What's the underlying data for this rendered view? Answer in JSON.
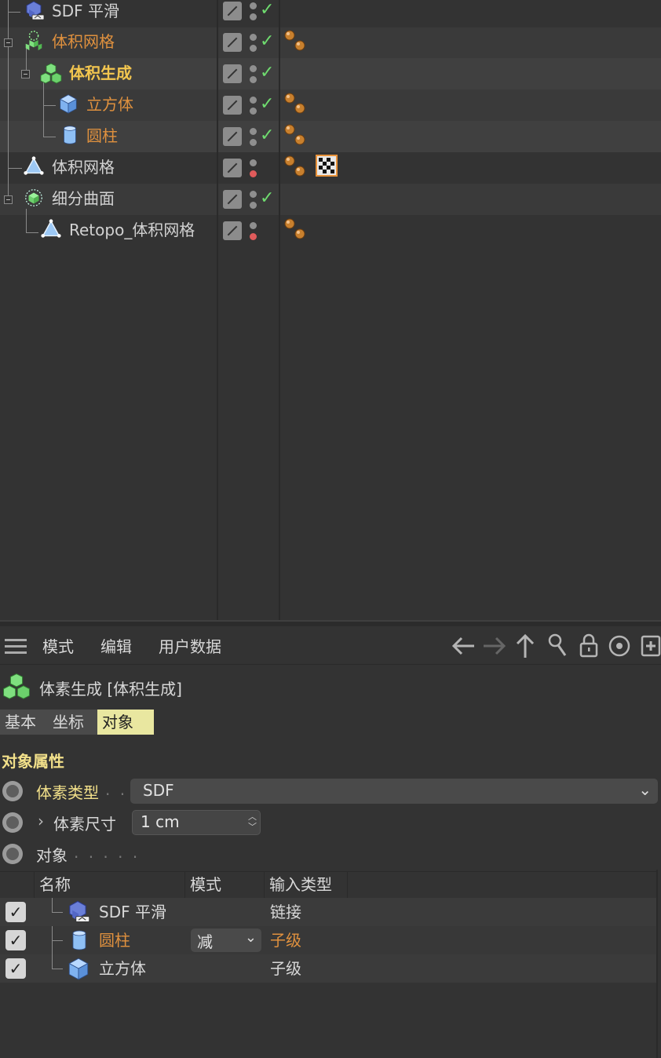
{
  "object_manager": {
    "rows": [
      {
        "name": "SDF 平滑",
        "color": "gray",
        "status": "on",
        "tag": "none"
      },
      {
        "name": "体积网格",
        "color": "orange",
        "status": "on",
        "tag": "material"
      },
      {
        "name": "体积生成",
        "color": "yellow",
        "status": "on",
        "tag": "none"
      },
      {
        "name": "立方体",
        "color": "orange",
        "status": "on",
        "tag": "material"
      },
      {
        "name": "圆柱",
        "color": "orange",
        "status": "on",
        "tag": "material"
      },
      {
        "name": "体积网格",
        "color": "gray",
        "status": "off",
        "tag": "material+texture"
      },
      {
        "name": "细分曲面",
        "color": "gray",
        "status": "on",
        "tag": "none"
      },
      {
        "name": "Retopo_体积网格",
        "color": "gray",
        "status": "off",
        "tag": "material"
      }
    ]
  },
  "attr_manager": {
    "menu": [
      "模式",
      "编辑",
      "用户数据"
    ],
    "header_title": "体素生成 [体积生成]",
    "tabs": [
      "基本",
      "坐标",
      "对象"
    ],
    "active_tab": "对象",
    "section_title": "对象属性",
    "props": {
      "voxel_type_label": "体素类型",
      "voxel_type_value": "SDF",
      "voxel_size_label": "体素尺寸",
      "voxel_size_value": "1 cm",
      "objects_label": "对象"
    },
    "table": {
      "headers": [
        "名称",
        "模式",
        "输入类型"
      ],
      "rows": [
        {
          "checked": true,
          "name": "SDF 平滑",
          "mode": "",
          "input_type": "链接",
          "highlight": false
        },
        {
          "checked": true,
          "name": "圆柱",
          "mode": "减",
          "input_type": "子级",
          "highlight": true
        },
        {
          "checked": true,
          "name": "立方体",
          "mode": "",
          "input_type": "子级",
          "highlight": false
        }
      ]
    }
  },
  "colors": {
    "orange": "#e0913e",
    "yellow": "#f3c64f",
    "check_green": "#6fdc6f",
    "disabled_red": "#e05b5b",
    "active_tab": "#e9e7a0"
  }
}
